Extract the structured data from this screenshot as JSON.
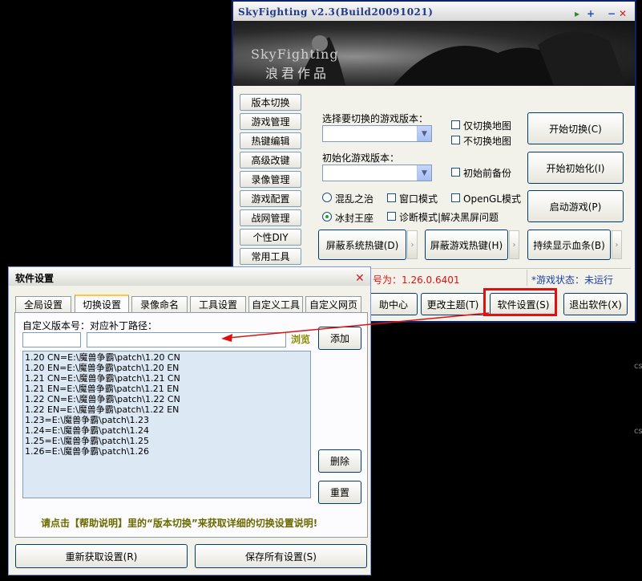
{
  "main_window": {
    "title": "SkyFighting v2.3(Build20091021)",
    "banner_title": "SkyFighting",
    "banner_subtitle": "浪君作品",
    "sidebar": [
      "版本切换",
      "游戏管理",
      "热键编辑",
      "高级改键",
      "录像管理",
      "游戏配置",
      "战网管理",
      "个性DIY",
      "常用工具"
    ],
    "select_version_label": "选择要切换的游戏版本：",
    "init_version_label": "初始化游戏版本：",
    "checkbox_only_map": "仅切换地图",
    "checkbox_no_map": "不切换地图",
    "checkbox_init_backup": "初始前备份",
    "radio_chaos": "混乱之治",
    "radio_frozen": "冰封王座",
    "checkbox_window": "窗口模式",
    "checkbox_opengl": "OpenGL模式",
    "checkbox_diagnose": "诊断模式|解决黑屏问题",
    "btn_start_switch": "开始切换(C)",
    "btn_start_init": "开始初始化(I)",
    "btn_launch": "启动游戏(P)",
    "btn_block_sys_hotkey": "屏蔽系统热键(D)",
    "btn_block_game_hotkey": "屏蔽游戏热键(H)",
    "btn_show_hp": "持续显示血条(B)",
    "version_text": "号为：1.26.0.6401",
    "game_status": "*游戏状态：未运行",
    "btn_help_center": "助中心",
    "btn_change_theme": "更改主题(T)",
    "btn_settings": "软件设置(S)",
    "btn_exit": "退出软件(X)",
    "side_text": "cs"
  },
  "dialog": {
    "title": "软件设置",
    "tabs": [
      "全局设置",
      "切换设置",
      "录像命名",
      "工具设置",
      "自定义工具",
      "自定义网页"
    ],
    "field_label": "自定义版本号：对应补丁路径：",
    "browse": "浏览",
    "btn_add": "添加",
    "btn_delete": "删除",
    "btn_reset": "重置",
    "list_items": [
      "1.20 CN=E:\\魔兽争霸\\patch\\1.20 CN",
      "1.20 EN=E:\\魔兽争霸\\patch\\1.20 EN",
      "1.21 CN=E:\\魔兽争霸\\patch\\1.21 CN",
      "1.21 EN=E:\\魔兽争霸\\patch\\1.21 EN",
      "1.22 CN=E:\\魔兽争霸\\patch\\1.22 CN",
      "1.22 EN=E:\\魔兽争霸\\patch\\1.22 EN",
      "1.23=E:\\魔兽争霸\\patch\\1.23",
      "1.24=E:\\魔兽争霸\\patch\\1.24",
      "1.25=E:\\魔兽争霸\\patch\\1.25",
      "1.26=E:\\魔兽争霸\\patch\\1.26"
    ],
    "hint": "请点击【帮助说明】里的“版本切换”来获取详细的切换设置说明!",
    "btn_reload": "重新获取设置(R)",
    "btn_save_all": "保存所有设置(S)"
  },
  "colors": {
    "accent_red": "#e01010",
    "status_blue": "#1c3fa0"
  }
}
